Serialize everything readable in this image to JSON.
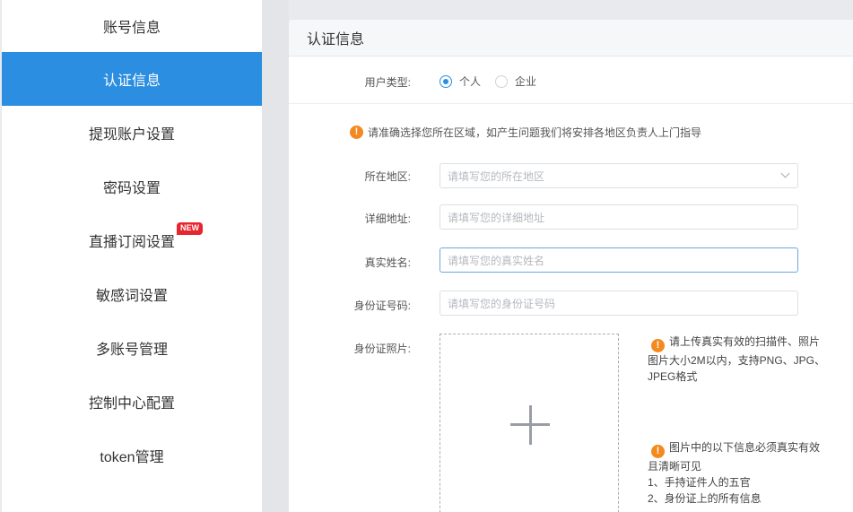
{
  "sidebar": {
    "items": [
      {
        "label": "账号信息"
      },
      {
        "label": "认证信息",
        "active": true
      },
      {
        "label": "提现账户设置"
      },
      {
        "label": "密码设置"
      },
      {
        "label": "直播订阅设置",
        "badge": "NEW"
      },
      {
        "label": "敏感词设置"
      },
      {
        "label": "多账号管理"
      },
      {
        "label": "控制中心配置"
      },
      {
        "label": "token管理"
      }
    ]
  },
  "panel": {
    "title": "认证信息",
    "user_type": {
      "label": "用户类型:",
      "options": [
        {
          "label": "个人",
          "checked": true
        },
        {
          "label": "企业",
          "checked": false
        }
      ]
    },
    "notice": "请准确选择您所在区域，如产生问题我们将安排各地区负责人上门指导",
    "fields": {
      "region": {
        "label": "所在地区:",
        "placeholder": "请填写您的所在地区"
      },
      "address": {
        "label": "详细地址:",
        "placeholder": "请填写您的详细地址"
      },
      "name": {
        "label": "真实姓名:",
        "placeholder": "请填写您的真实姓名"
      },
      "id_number": {
        "label": "身份证号码:",
        "placeholder": "请填写您的身份证号码"
      },
      "id_photo": {
        "label": "身份证照片:"
      }
    },
    "tips": {
      "upload": "请上传真实有效的扫描件、照片图片大小2M以内，支持PNG、JPG、JPEG格式",
      "require_title": "图片中的以下信息必须真实有效且清晰可见",
      "require_1": "1、手持证件人的五官",
      "require_2": "2、身份证上的所有信息"
    }
  },
  "colors": {
    "accent": "#2b8ee0",
    "warning": "#f4891f",
    "badge": "#e6262e"
  }
}
